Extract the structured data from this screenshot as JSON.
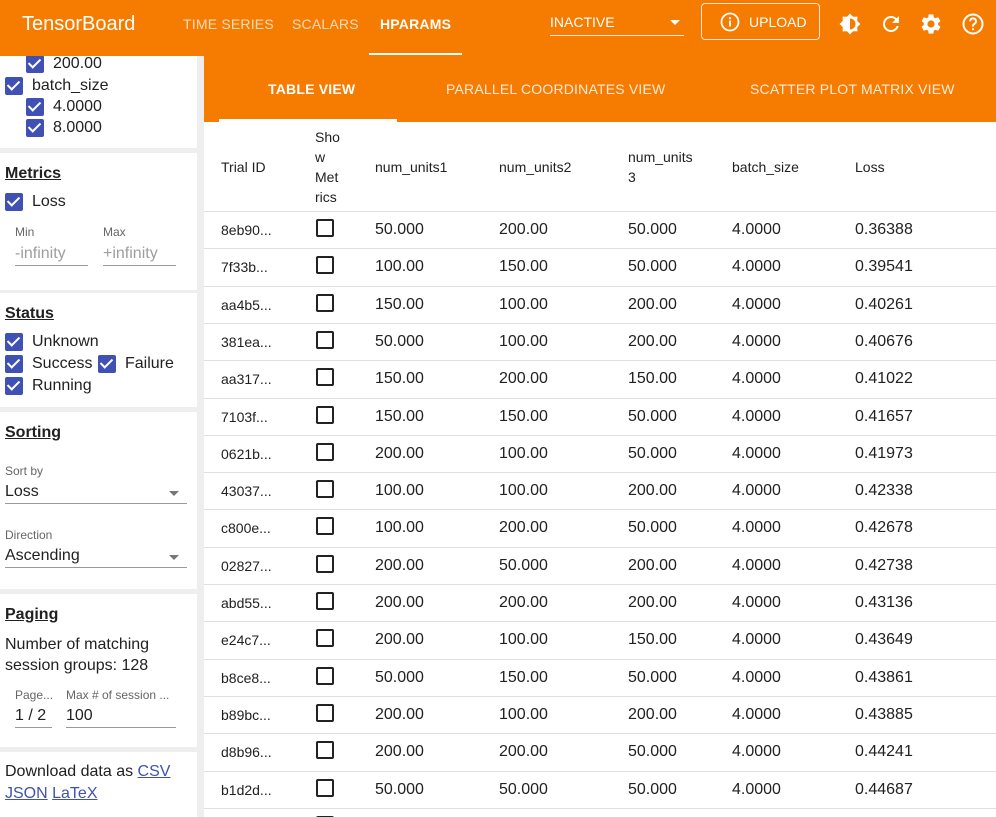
{
  "app": {
    "title": "TensorBoard",
    "nav_tabs": [
      "TIME SERIES",
      "SCALARS",
      "HPARAMS"
    ],
    "active_tab": "HPARAMS",
    "plugin_select": "INACTIVE",
    "upload_label": "UPLOAD",
    "icons": [
      "info-icon",
      "theme-icon",
      "refresh-icon",
      "settings-icon",
      "help-icon"
    ],
    "accent_color": "#f57c00",
    "checkbox_color": "#3f51b5"
  },
  "sidebar": {
    "hparam_values_top": [
      "200.00"
    ],
    "batch_size": {
      "label": "batch_size",
      "values": [
        "4.0000",
        "8.0000"
      ]
    },
    "metrics": {
      "title": "Metrics",
      "loss_label": "Loss",
      "min_label": "Min",
      "min_placeholder": "-infinity",
      "max_label": "Max",
      "max_placeholder": "+infinity"
    },
    "status": {
      "title": "Status",
      "unknown": "Unknown",
      "success": "Success",
      "failure": "Failure",
      "running": "Running"
    },
    "sorting": {
      "title": "Sorting",
      "sort_by_label": "Sort by",
      "sort_by_value": "Loss",
      "direction_label": "Direction",
      "direction_value": "Ascending"
    },
    "paging": {
      "title": "Paging",
      "matching_text": "Number of matching session groups: 128",
      "page_label": "Page...",
      "page_value": "1",
      "page_total": "/ 2",
      "max_label": "Max # of session ...",
      "max_value": "100"
    },
    "download": {
      "prefix": "Download data as",
      "csv": "CSV",
      "json": "JSON",
      "latex": "LaTeX"
    }
  },
  "main": {
    "view_tabs": [
      "TABLE VIEW",
      "PARALLEL COORDINATES VIEW",
      "SCATTER PLOT MATRIX VIEW"
    ],
    "active_view": "TABLE VIEW",
    "columns": {
      "trial_id": "Trial ID",
      "show_metrics": [
        "Sho",
        "w",
        "Met",
        "rics"
      ],
      "num_units1": "num_units1",
      "num_units2": "num_units2",
      "num_units3": [
        "num_units",
        "3"
      ],
      "batch_size": "batch_size",
      "loss": "Loss"
    },
    "rows": [
      {
        "id": "8eb90...",
        "u1": "50.000",
        "u2": "200.00",
        "u3": "50.000",
        "bs": "4.0000",
        "loss": "0.36388"
      },
      {
        "id": "7f33b...",
        "u1": "100.00",
        "u2": "150.00",
        "u3": "50.000",
        "bs": "4.0000",
        "loss": "0.39541"
      },
      {
        "id": "aa4b5...",
        "u1": "150.00",
        "u2": "100.00",
        "u3": "200.00",
        "bs": "4.0000",
        "loss": "0.40261"
      },
      {
        "id": "381ea...",
        "u1": "50.000",
        "u2": "100.00",
        "u3": "200.00",
        "bs": "4.0000",
        "loss": "0.40676"
      },
      {
        "id": "aa317...",
        "u1": "150.00",
        "u2": "200.00",
        "u3": "150.00",
        "bs": "4.0000",
        "loss": "0.41022"
      },
      {
        "id": "7103f...",
        "u1": "150.00",
        "u2": "150.00",
        "u3": "50.000",
        "bs": "4.0000",
        "loss": "0.41657"
      },
      {
        "id": "0621b...",
        "u1": "200.00",
        "u2": "100.00",
        "u3": "50.000",
        "bs": "4.0000",
        "loss": "0.41973"
      },
      {
        "id": "43037...",
        "u1": "100.00",
        "u2": "100.00",
        "u3": "200.00",
        "bs": "4.0000",
        "loss": "0.42338"
      },
      {
        "id": "c800e...",
        "u1": "100.00",
        "u2": "200.00",
        "u3": "50.000",
        "bs": "4.0000",
        "loss": "0.42678"
      },
      {
        "id": "02827...",
        "u1": "200.00",
        "u2": "50.000",
        "u3": "200.00",
        "bs": "4.0000",
        "loss": "0.42738"
      },
      {
        "id": "abd55...",
        "u1": "200.00",
        "u2": "200.00",
        "u3": "200.00",
        "bs": "4.0000",
        "loss": "0.43136"
      },
      {
        "id": "e24c7...",
        "u1": "200.00",
        "u2": "100.00",
        "u3": "150.00",
        "bs": "4.0000",
        "loss": "0.43649"
      },
      {
        "id": "b8ce8...",
        "u1": "50.000",
        "u2": "150.00",
        "u3": "50.000",
        "bs": "4.0000",
        "loss": "0.43861"
      },
      {
        "id": "b89bc...",
        "u1": "200.00",
        "u2": "100.00",
        "u3": "200.00",
        "bs": "4.0000",
        "loss": "0.43885"
      },
      {
        "id": "d8b96...",
        "u1": "200.00",
        "u2": "200.00",
        "u3": "50.000",
        "bs": "4.0000",
        "loss": "0.44241"
      },
      {
        "id": "b1d2d...",
        "u1": "50.000",
        "u2": "50.000",
        "u3": "50.000",
        "bs": "4.0000",
        "loss": "0.44687"
      }
    ]
  }
}
